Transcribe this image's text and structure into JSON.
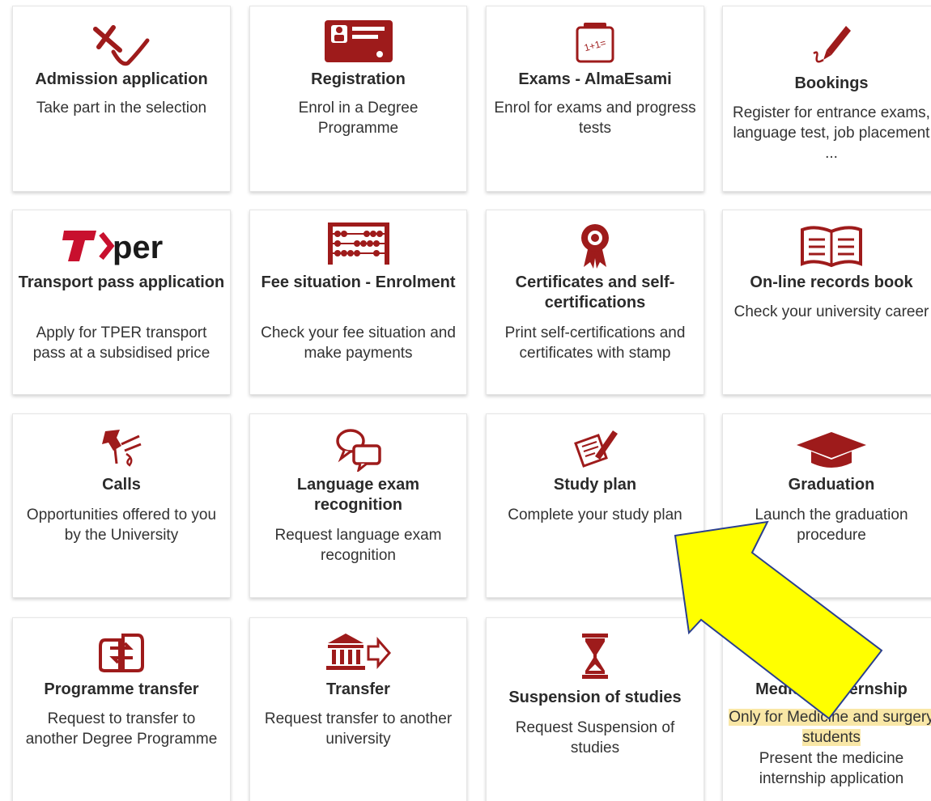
{
  "colors": {
    "accent": "#9e1b1b",
    "highlight": "#f9e7a6",
    "arrow_fill": "#ffff00",
    "arrow_stroke": "#2a3f8f"
  },
  "cards": [
    {
      "title": "Admission application",
      "desc": "Take part in the selection",
      "icon": "check-x-icon"
    },
    {
      "title": "Registration",
      "desc": "Enrol in a Degree Programme",
      "icon": "id-card-icon"
    },
    {
      "title": "Exams - AlmaEsami",
      "desc": "Enrol for exams and progress tests",
      "icon": "calculation-icon"
    },
    {
      "title": "Bookings",
      "desc": "Register for entrance exams, language test, job placement ...",
      "icon": "pen-icon"
    },
    {
      "title": "Transport pass application",
      "desc": "Apply for TPER transport pass at a subsidised price",
      "icon": "tper-logo",
      "logo_text": "T›per"
    },
    {
      "title": "Fee situation - Enrolment",
      "desc": "Check your fee situation and make payments",
      "icon": "abacus-icon"
    },
    {
      "title": "Certificates and self-certifications",
      "desc": "Print self-certifications and certificates with stamp",
      "icon": "award-ribbon-icon"
    },
    {
      "title": "On-line records book",
      "desc": "Check your university career",
      "icon": "open-book-icon"
    },
    {
      "title": "Calls",
      "desc": "Opportunities offered to you by the University",
      "icon": "pushpin-icon"
    },
    {
      "title": "Language exam recognition",
      "desc": "Request language exam recognition",
      "icon": "speech-bubbles-icon"
    },
    {
      "title": "Study plan",
      "desc": "Complete your study plan",
      "icon": "writing-paper-icon"
    },
    {
      "title": "Graduation",
      "desc": "Launch the graduation procedure",
      "icon": "graduation-cap-icon"
    },
    {
      "title": "Programme transfer",
      "desc": "Request to transfer to another Degree Programme",
      "icon": "transfer-arrows-icon"
    },
    {
      "title": "Transfer",
      "desc": "Request transfer to another university",
      "icon": "university-arrow-icon"
    },
    {
      "title": "Suspension of studies",
      "desc": "Request Suspension of studies",
      "icon": "hourglass-icon"
    },
    {
      "title": "Medicine internship",
      "note": "Only for Medicine and surgery students",
      "desc": "Present the medicine internship application",
      "icon": "none"
    }
  ]
}
